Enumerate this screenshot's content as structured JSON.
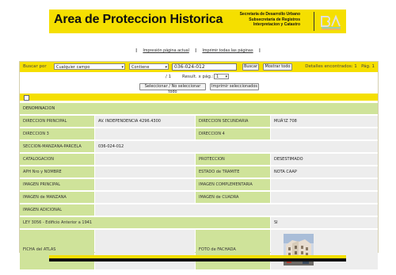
{
  "header": {
    "title": "Area de Proteccion Historica",
    "sub1": "Secretaría de Desarrollo Urbano",
    "sub2": "Subsecretaría de Registros",
    "sub3": "Interpretacion y Catastro",
    "logo": "BA"
  },
  "print": {
    "current": "Impresión página actual",
    "all": "Imprimir todas las páginas",
    "sep": "|"
  },
  "search": {
    "label": "Buscar por",
    "field": "Cualquier campo",
    "operator": "Contiene",
    "value": "036-024-012",
    "search_btn": "Buscar",
    "show_all_btn": "Mostrar todo",
    "found_text": "Detalles encontrados: 1",
    "page_label": "Pág. 1"
  },
  "pager": {
    "position": "/ 1",
    "results_label": "Result. x pág.:",
    "results_value": "1"
  },
  "actions": {
    "toggle_select": "Seleccionar / No seleccionar todo",
    "print_selected": "Imprimir seleccionados"
  },
  "record": {
    "denominacion_label": "DENOMINACION",
    "dir_principal_label": "DIRECCION PRINCIPAL",
    "dir_principal": "AV. INDEPENDENCIA 4296.4300",
    "dir_secundaria_label": "DIRECCION SECUNDARIA",
    "dir_secundaria": "MUÃ'IZ 708",
    "dir3_label": "DIRECCION 3",
    "dir4_label": "DIRECCION 4",
    "smp_label": "SECCION-MANZANA-PARCELA",
    "smp": "036-024-012",
    "catalogacion_label": "CATALOGACION",
    "proteccion_label": "PROTECCION",
    "proteccion": "DESESTIMADO",
    "aph_label": "APH Nro y NOMBRE",
    "estado_label": "ESTADO de TRAMITE",
    "estado": "NOTA CAAP",
    "img_principal_label": "IMAGEN PRINCIPAL",
    "img_complementaria_label": "IMAGEN COMPLEMENTARIA",
    "img_manzana_label": "IMAGEN de MANZANA",
    "img_cuadra_label": "IMAGEN de CUADRA",
    "img_adicional_label": "IMAGEN ADICIONAL",
    "ley_label": "LEY 3056 - Edificio Anterior a 1941",
    "ley_value": "SI",
    "ficha_label": "FICHA del ATLAS",
    "foto_label": "FOTO de FACHADA"
  },
  "colors": {
    "brand_yellow": "#f5df00",
    "label_green": "#cfe39a",
    "value_gray": "#ededed"
  }
}
